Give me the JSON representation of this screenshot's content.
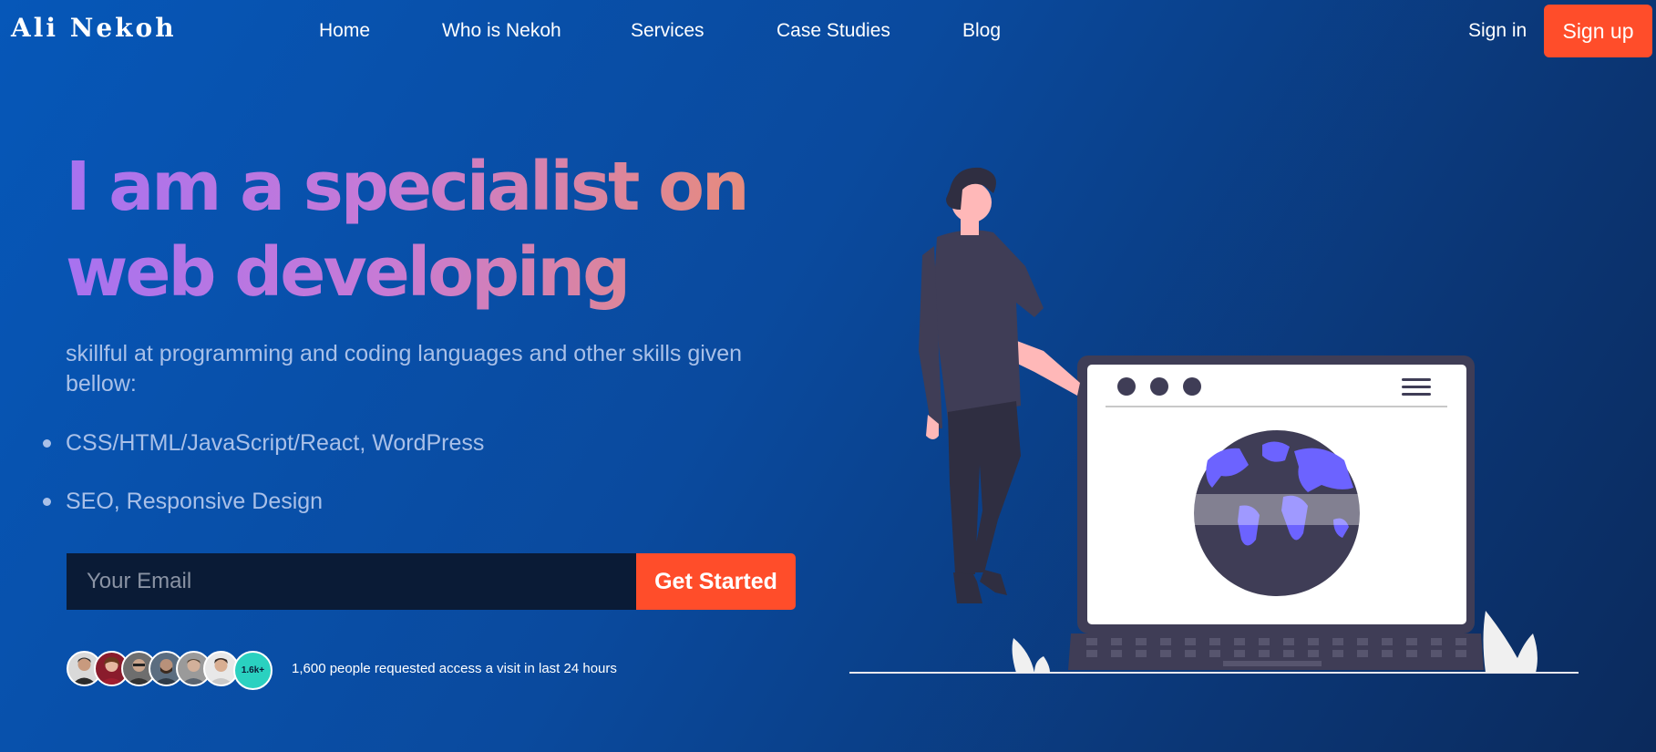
{
  "nav": {
    "logo": "Ali Nekoh",
    "links": [
      {
        "label": "Home"
      },
      {
        "label": "Who is Nekoh"
      },
      {
        "label": "Services"
      },
      {
        "label": "Case Studies"
      },
      {
        "label": "Blog"
      }
    ],
    "sign_in": "Sign in",
    "sign_up": "Sign up"
  },
  "hero": {
    "title_line1": "I am a specialist on",
    "title_line2": "web developing",
    "subtitle": "skillful at programming and coding languages and other skills given bellow:",
    "skills": [
      "CSS/HTML/JavaScript/React, WordPress",
      "SEO, Responsive Design"
    ],
    "email_placeholder": "Your Email",
    "cta_label": "Get Started",
    "avatar_count": "1.6k+",
    "social_proof": "1,600 people requested access a visit in last 24 hours"
  },
  "colors": {
    "accent": "#ff4d2a",
    "background": "#0a4a9e",
    "title_gradient_start": "#a772f0",
    "title_gradient_end": "#e88c7a",
    "count_badge": "#2ad1c0"
  }
}
